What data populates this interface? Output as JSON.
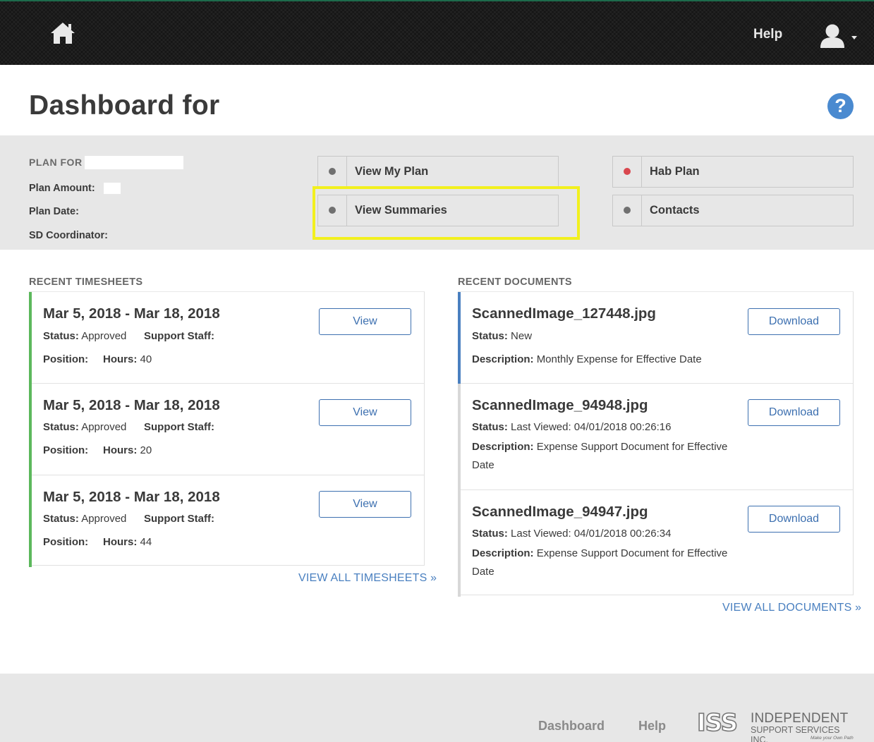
{
  "nav": {
    "help_label": "Help"
  },
  "page": {
    "title": "Dashboard for"
  },
  "plan": {
    "plan_for_label": "PLAN FOR",
    "amount_label": "Plan Amount:",
    "date_label": "Plan Date:",
    "coordinator_label": "SD Coordinator:",
    "buttons": [
      {
        "label": "View My Plan",
        "dot_color": "#707070"
      },
      {
        "label": "View Summaries",
        "dot_color": "#707070"
      },
      {
        "label": "Hab Plan",
        "dot_color": "#d9474e"
      },
      {
        "label": "Contacts",
        "dot_color": "#707070"
      }
    ]
  },
  "timesheets": {
    "heading": "RECENT TIMESHEETS",
    "status_label": "Status:",
    "support_label": "Support Staff:",
    "position_label": "Position:",
    "hours_label": "Hours:",
    "button_label": "View",
    "items": [
      {
        "range": "Mar 5, 2018 - Mar 18, 2018",
        "status": "Approved",
        "hours": "40"
      },
      {
        "range": "Mar 5, 2018 - Mar 18, 2018",
        "status": "Approved",
        "hours": "20"
      },
      {
        "range": "Mar 5, 2018 - Mar 18, 2018",
        "status": "Approved",
        "hours": "44"
      }
    ],
    "view_all": "VIEW ALL TIMESHEETS »"
  },
  "documents": {
    "heading": "RECENT DOCUMENTS",
    "status_label": "Status:",
    "description_label": "Description:",
    "button_label": "Download",
    "items": [
      {
        "name": "ScannedImage_127448.jpg",
        "status": "New",
        "description": "Monthly Expense for Effective Date"
      },
      {
        "name": "ScannedImage_94948.jpg",
        "status": "Last Viewed: 04/01/2018 00:26:16",
        "description": "Expense Support Document for Effective Date"
      },
      {
        "name": "ScannedImage_94947.jpg",
        "status": "Last Viewed: 04/01/2018 00:26:34",
        "description": "Expense Support Document for Effective Date"
      }
    ],
    "view_all": "VIEW ALL DOCUMENTS »"
  },
  "footer": {
    "links": [
      "Dashboard",
      "Help"
    ],
    "logo": {
      "mark": "ISS",
      "line1": "INDEPENDENT",
      "line2": "SUPPORT SERVICES INC.",
      "tagline": "Make your Own Path"
    }
  },
  "colors": {
    "accent_blue": "#3d70b0",
    "timesheet_accent": "#5cb85c",
    "document_accent_active": "#4a80c0",
    "document_accent_default": "#d8d8d8",
    "highlight": "#f2f01e"
  }
}
